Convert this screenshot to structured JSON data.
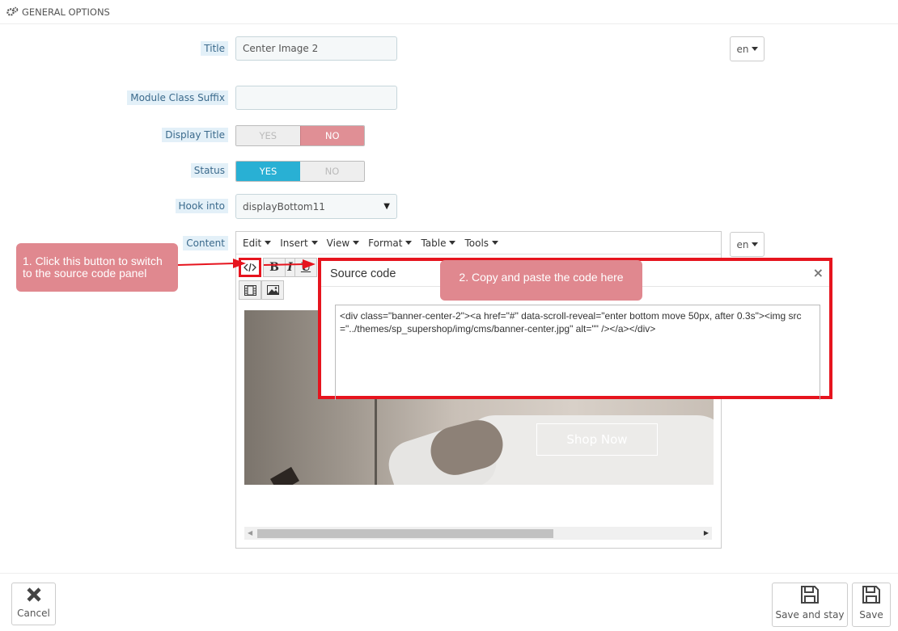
{
  "section": {
    "title": "GENERAL OPTIONS",
    "icon": "gears-icon"
  },
  "form": {
    "title_label": "Title",
    "title_value": "Center Image 2",
    "lang": "en",
    "suffix_label": "Module Class Suffix",
    "suffix_value": "",
    "display_title_label": "Display Title",
    "status_label": "Status",
    "yes": "YES",
    "no": "NO",
    "hook_label": "Hook into",
    "hook_value": "displayBottom11",
    "content_label": "Content"
  },
  "toggles": {
    "display_title": "NO",
    "status": "YES"
  },
  "editor": {
    "menu": [
      "Edit",
      "Insert",
      "View",
      "Format",
      "Table",
      "Tools"
    ],
    "bold": "B",
    "italic": "I",
    "underline": "U",
    "shop_now": "Shop Now"
  },
  "callouts": {
    "step1": "1. Click this button to switch to the source code panel",
    "step2": "2. Copy and paste the code here"
  },
  "source_dialog": {
    "title": "Source code",
    "close": "×",
    "code": "<div class=\"banner-center-2\"><a href=\"#\" data-scroll-reveal=\"enter bottom move 50px, after 0.3s\"><img src=\"../themes/sp_supershop/img/cms/banner-center.jpg\" alt=\"\" /></a></div>"
  },
  "footer": {
    "cancel": "Cancel",
    "save_stay": "Save and stay",
    "save": "Save"
  },
  "colors": {
    "accent_red": "#e6141e",
    "callout": "#e0888f",
    "yes_blue": "#29b0d4",
    "no_red": "#e08f95"
  }
}
